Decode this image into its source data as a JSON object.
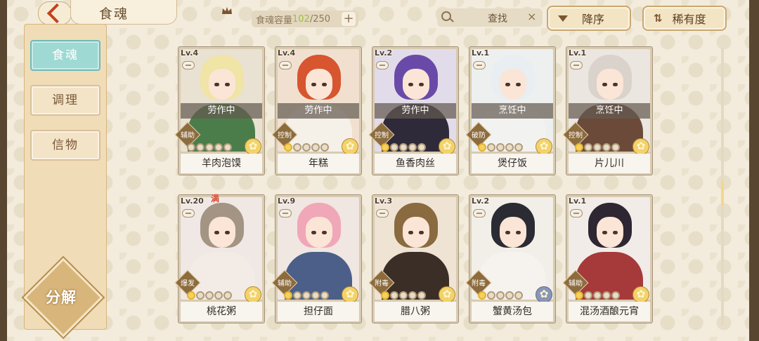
{
  "header": {
    "title": "食魂",
    "capacity_label": "食魂容量",
    "capacity_used": "102",
    "capacity_total": "/250",
    "add_label": "+",
    "search_label": "查找",
    "clear_label": "×",
    "sort_desc_label": "降序",
    "sort_rarity_label": "稀有度"
  },
  "sidebar": {
    "items": [
      {
        "label": "食魂"
      },
      {
        "label": "调理"
      },
      {
        "label": "信物"
      }
    ],
    "decompose_label": "分解"
  },
  "cards": [
    {
      "level": "Lv.4",
      "name": "羊肉泡馍",
      "status": "劳作中",
      "role": "辅助",
      "stars": 0,
      "flower": "gold",
      "full": ""
    },
    {
      "level": "Lv.4",
      "name": "年糕",
      "status": "劳作中",
      "role": "控制",
      "stars": 1,
      "flower": "gold",
      "full": ""
    },
    {
      "level": "Lv.2",
      "name": "鱼香肉丝",
      "status": "劳作中",
      "role": "控制",
      "stars": 1,
      "flower": "gold",
      "full": ""
    },
    {
      "level": "Lv.1",
      "name": "煲仔饭",
      "status": "烹饪中",
      "role": "破防",
      "stars": 1,
      "flower": "gold",
      "full": ""
    },
    {
      "level": "Lv.1",
      "name": "片儿川",
      "status": "烹饪中",
      "role": "控制",
      "stars": 1,
      "flower": "gold",
      "full": ""
    },
    {
      "level": "Lv.20",
      "name": "桃花粥",
      "status": "",
      "role": "爆发",
      "stars": 1,
      "flower": "gold",
      "full": "满"
    },
    {
      "level": "Lv.9",
      "name": "担仔面",
      "status": "",
      "role": "辅助",
      "stars": 1,
      "flower": "gold",
      "full": ""
    },
    {
      "level": "Lv.3",
      "name": "腊八粥",
      "status": "",
      "role": "附毒",
      "stars": 1,
      "flower": "gold",
      "full": ""
    },
    {
      "level": "Lv.2",
      "name": "蟹黄汤包",
      "status": "",
      "role": "附毒",
      "stars": 1,
      "flower": "blue",
      "full": ""
    },
    {
      "level": "Lv.1",
      "name": "混汤酒酿元宵",
      "status": "",
      "role": "辅助",
      "stars": 1,
      "flower": "gold",
      "full": ""
    }
  ],
  "colors": {
    "accent_active": "#9fd9d4",
    "status_overlay": "#645a50",
    "star_filled": "#f6d15c"
  }
}
